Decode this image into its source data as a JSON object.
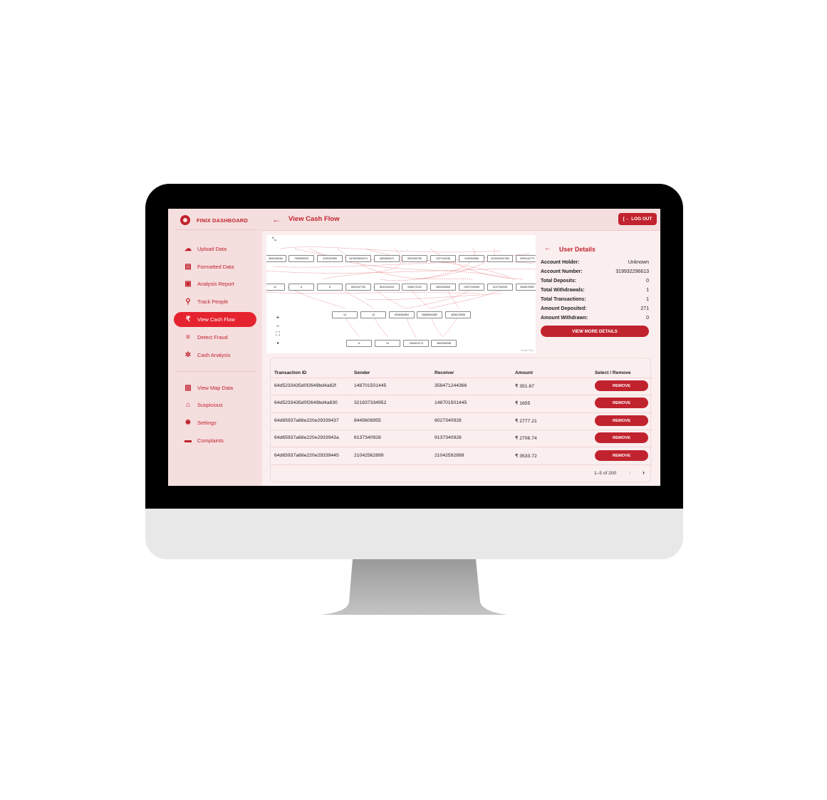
{
  "app": {
    "brand": "FINIX DASHBOARD",
    "page_title": "View Cash Flow",
    "logout_label": "LOG OUT"
  },
  "colors": {
    "accent": "#c1232e",
    "active_nav": "#e5232e",
    "sidebar_bg": "#f5dede",
    "content_bg": "#fbeeee"
  },
  "sidebar": {
    "items": [
      {
        "label": "Upload Data",
        "icon": "cloud-upload-icon",
        "glyph": "☁",
        "active": false
      },
      {
        "label": "Formatted Data",
        "icon": "document-icon",
        "glyph": "▤",
        "active": false
      },
      {
        "label": "Analysis Report",
        "icon": "clipboard-icon",
        "glyph": "▣",
        "active": false
      },
      {
        "label": "Track People",
        "icon": "search-icon",
        "glyph": "⚲",
        "active": false
      },
      {
        "label": "View Cash Flow",
        "icon": "rupee-icon",
        "glyph": "₹",
        "active": true
      },
      {
        "label": "Detect Fraud",
        "icon": "filter-search-icon",
        "glyph": "≡",
        "active": false
      },
      {
        "label": "Cash Analysis",
        "icon": "gear-cog-icon",
        "glyph": "✲",
        "active": false
      }
    ],
    "items2": [
      {
        "label": "View Map Data",
        "icon": "map-icon",
        "glyph": "▥",
        "active": false
      },
      {
        "label": "Suspicious",
        "icon": "bank-icon",
        "glyph": "⌂",
        "active": false
      },
      {
        "label": "Settings",
        "icon": "settings-icon",
        "glyph": "✹",
        "active": false
      },
      {
        "label": "Complaints",
        "icon": "chat-icon",
        "glyph": "▬",
        "active": false
      }
    ]
  },
  "flow": {
    "attribution": "React Flow",
    "row1": [
      "3842948164",
      "7283989029",
      "3199322983",
      "3478003830474",
      "4893828474",
      "9923430789",
      "1327140108",
      "3199300080",
      "3220923947284",
      "3309144773"
    ],
    "row2": [
      "12",
      "8",
      "8",
      "8042347784",
      "8042443443",
      "4358170242",
      "4803282808",
      "19027343906",
      "6137340928",
      "2608076082"
    ],
    "row3": [
      "14",
      "13",
      "6098384894",
      "26880802880",
      "4836243836"
    ],
    "row4": [
      "11",
      "15",
      "7082823174",
      "4805398258"
    ]
  },
  "user_details": {
    "title": "User Details",
    "fields": [
      {
        "label": "Account Holder:",
        "value": "Unknown"
      },
      {
        "label": "Account Number:",
        "value": "319932296613"
      },
      {
        "label": "Total Deposits:",
        "value": "0"
      },
      {
        "label": "Total Withdrawals:",
        "value": "1"
      },
      {
        "label": "Total Transactions:",
        "value": "1"
      },
      {
        "label": "Amount Deposited:",
        "value": "271"
      },
      {
        "label": "Amount Withdrawn:",
        "value": "0"
      }
    ],
    "button_label": "VIEW MORE DETAILS"
  },
  "table": {
    "columns": [
      "Transaction ID",
      "Sender",
      "Receiver",
      "Amount",
      "Select / Remove"
    ],
    "rows": [
      {
        "id": "64d5233435d0f2649bd4a82f",
        "sender": "148701501445",
        "receiver": "358471244366",
        "amount": "₹ 351.67",
        "action": "REMOVE"
      },
      {
        "id": "64d5233435d0f2649bd4a830",
        "sender": "321837334952",
        "receiver": "148701501445",
        "amount": "₹ 1655",
        "action": "REMOVE"
      },
      {
        "id": "64d65937a68e220e29339437",
        "sender": "8445608955",
        "receiver": "6027340928",
        "amount": "₹ 2777.21",
        "action": "REMOVE"
      },
      {
        "id": "64d65937a68e220e2933943a",
        "sender": "6137340928",
        "receiver": "9137340928",
        "amount": "₹ 2706.74",
        "action": "REMOVE"
      },
      {
        "id": "64d65937a68e220e29339445",
        "sender": "21042562899",
        "receiver": "21042592899",
        "amount": "₹ 3533.72",
        "action": "REMOVE"
      }
    ],
    "pagination": "1–5 of 200",
    "prev_glyph": "‹",
    "next_glyph": "›"
  }
}
